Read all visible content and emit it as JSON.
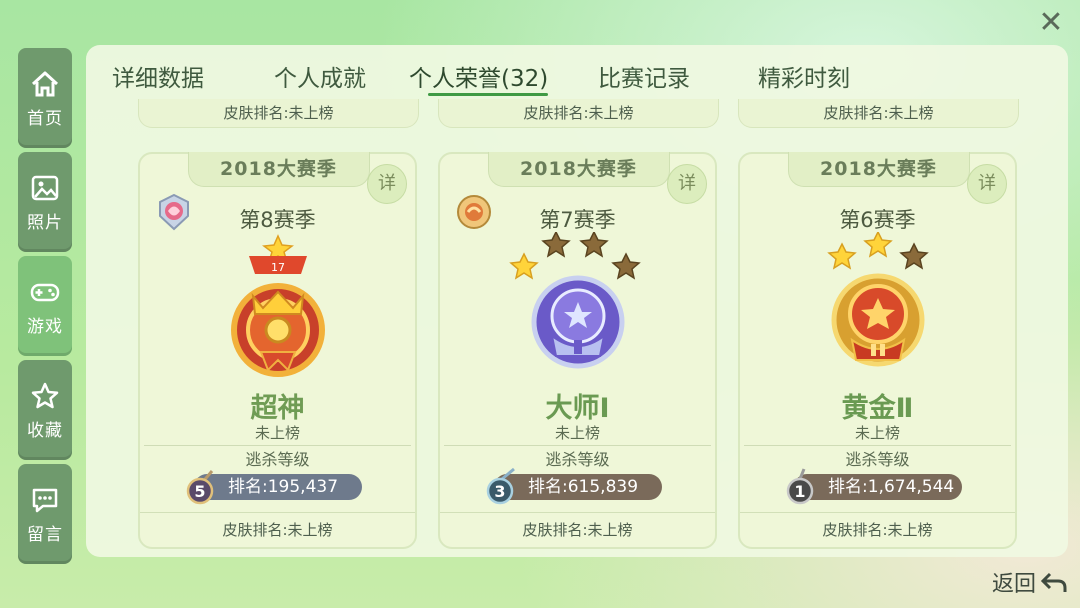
{
  "sidebar": {
    "items": [
      {
        "label": "首页",
        "icon": "home-icon"
      },
      {
        "label": "照片",
        "icon": "photo-icon"
      },
      {
        "label": "游戏",
        "icon": "gamepad-icon",
        "active": true
      },
      {
        "label": "收藏",
        "icon": "star-icon"
      },
      {
        "label": "留言",
        "icon": "message-icon"
      }
    ]
  },
  "tabs": [
    {
      "label": "详细数据"
    },
    {
      "label": "个人成就"
    },
    {
      "label": "个人荣誉(32)",
      "active": true
    },
    {
      "label": "比赛记录"
    },
    {
      "label": "精彩时刻"
    }
  ],
  "top_cards": [
    {
      "text": "皮肤排名:未上榜"
    },
    {
      "text": "皮肤排名:未上榜"
    },
    {
      "text": "皮肤排名:未上榜"
    }
  ],
  "cards": [
    {
      "season_tag": "2018大赛季",
      "detail": "详",
      "season": "第8赛季",
      "rank_name": "超神",
      "rank_sub": "未上榜",
      "tier_label": "逃杀等级",
      "rank_level": "5",
      "rank_text": "排名:195,437",
      "skin_rank": "皮肤排名:未上榜",
      "medal_badge_number": "17",
      "medal": "supreme-medal-icon",
      "accent": "#d9452b"
    },
    {
      "season_tag": "2018大赛季",
      "detail": "详",
      "season": "第7赛季",
      "rank_name": "大师Ⅰ",
      "rank_sub": "未上榜",
      "tier_label": "逃杀等级",
      "rank_level": "3",
      "rank_text": "排名:615,839",
      "skin_rank": "皮肤排名:未上榜",
      "stars_filled": 1,
      "stars_total": 4,
      "medal": "master-medal-icon",
      "accent": "#7d6bd1"
    },
    {
      "season_tag": "2018大赛季",
      "detail": "详",
      "season": "第6赛季",
      "rank_name": "黄金Ⅱ",
      "rank_sub": "未上榜",
      "tier_label": "逃杀等级",
      "rank_level": "1",
      "rank_text": "排名:1,674,544",
      "skin_rank": "皮肤排名:未上榜",
      "stars_filled": 2,
      "stars_total": 3,
      "medal": "gold-medal-icon",
      "accent": "#e0a32a"
    }
  ],
  "back_label": "返回"
}
